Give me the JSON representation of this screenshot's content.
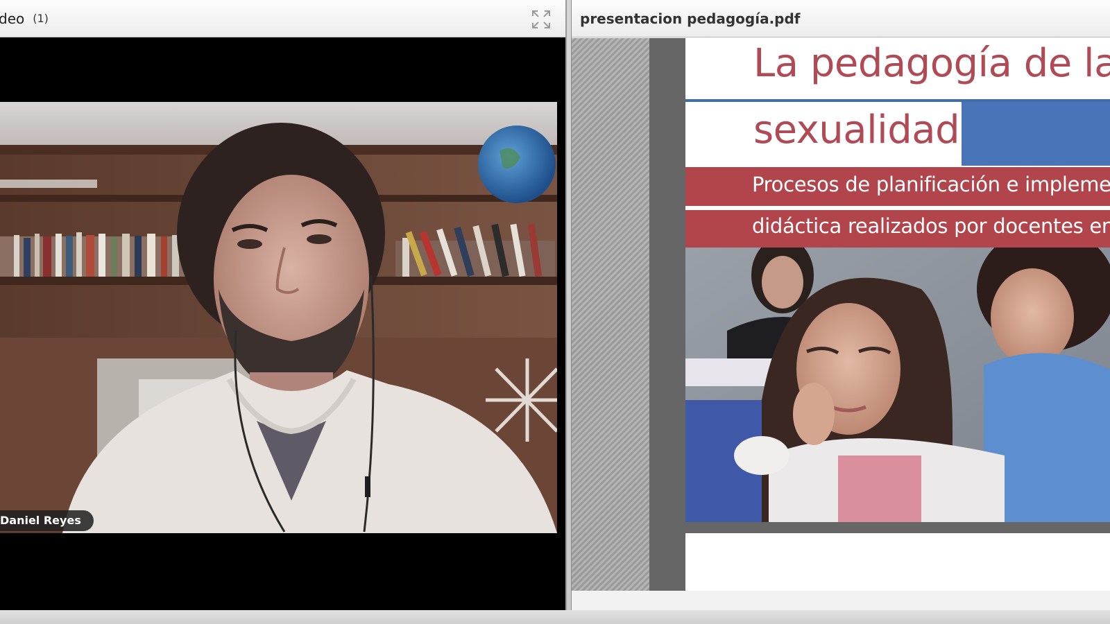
{
  "video_pod": {
    "title": "deo",
    "count": "(1)",
    "fullscreen_icon": "expand-icon",
    "participant_name": "Daniel Reyes"
  },
  "document_pod": {
    "filename": "presentacion pedagogía.pdf",
    "slide": {
      "title_line1": "La pedagogía de la",
      "title_line2": "sexualidad",
      "subtitle_line1": "Procesos de planificación e implementación",
      "subtitle_line2": "didáctica realizados por docentes en"
    }
  },
  "colors": {
    "slide_title": "#b04a55",
    "slide_band": "#b1454b",
    "slide_accent_blue": "#4a74b8"
  }
}
